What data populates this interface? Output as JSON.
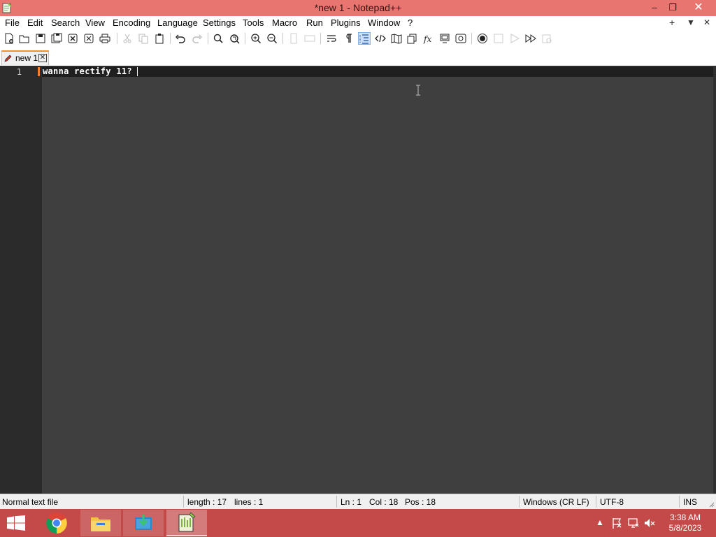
{
  "window": {
    "title": "*new 1 - Notepad++",
    "minimize": "–",
    "maximize": "❐",
    "close": "✕"
  },
  "menu": {
    "items": [
      "File",
      "Edit",
      "Search",
      "View",
      "Encoding",
      "Language",
      "Settings",
      "Tools",
      "Macro",
      "Run",
      "Plugins",
      "Window",
      "?"
    ],
    "right_controls": [
      "+",
      "▼",
      "✕"
    ]
  },
  "toolbar": {
    "icons": [
      "new-file-icon",
      "open-file-icon",
      "save-icon",
      "save-all-icon",
      "close-icon",
      "close-all-icon",
      "print-icon",
      "cut-icon",
      "copy-icon",
      "paste-icon",
      "undo-icon",
      "redo-icon",
      "find-icon",
      "replace-icon",
      "zoom-in-icon",
      "zoom-out-icon",
      "sync-vertical-icon",
      "sync-horizontal-icon",
      "word-wrap-icon",
      "show-all-characters-icon",
      "indent-guide-icon",
      "xml-tag-icon",
      "document-map-icon",
      "clone-icon",
      "function-list-icon",
      "monitoring-icon",
      "folder-as-workspace-icon",
      "record-macro-icon",
      "stop-recording-icon",
      "play-macro-icon",
      "run-macro-multiple-icon",
      "save-macro-icon"
    ],
    "active_icon": "indent-guide-icon"
  },
  "tabs": [
    {
      "label": "new 1",
      "close": "✕"
    }
  ],
  "editor": {
    "line_number": "1",
    "text": "wanna rectify 11?",
    "theme_bg": "#3f3f3f",
    "gutter_bg": "#2b2b2b",
    "current_line_bg": "#1f1f1f",
    "modified_marker_color": "#f07d30"
  },
  "status": {
    "file_type": "Normal text file",
    "length": "length : 17",
    "lines": "lines : 1",
    "ln": "Ln : 1",
    "col": "Col : 18",
    "pos": "Pos : 18",
    "eol": "Windows (CR LF)",
    "encoding": "UTF-8",
    "mode": "INS"
  },
  "taskbar": {
    "accent": "#c44a4a",
    "apps": [
      "windows-start-icon",
      "chrome-icon",
      "file-explorer-icon",
      "app-installer-icon",
      "notepad-plus-plus-icon"
    ],
    "tray": [
      "show-hidden-icons-arrow",
      "action-center-flag-icon",
      "network-icon",
      "volume-muted-icon"
    ],
    "time": "3:38 AM",
    "date": "5/8/2023"
  }
}
